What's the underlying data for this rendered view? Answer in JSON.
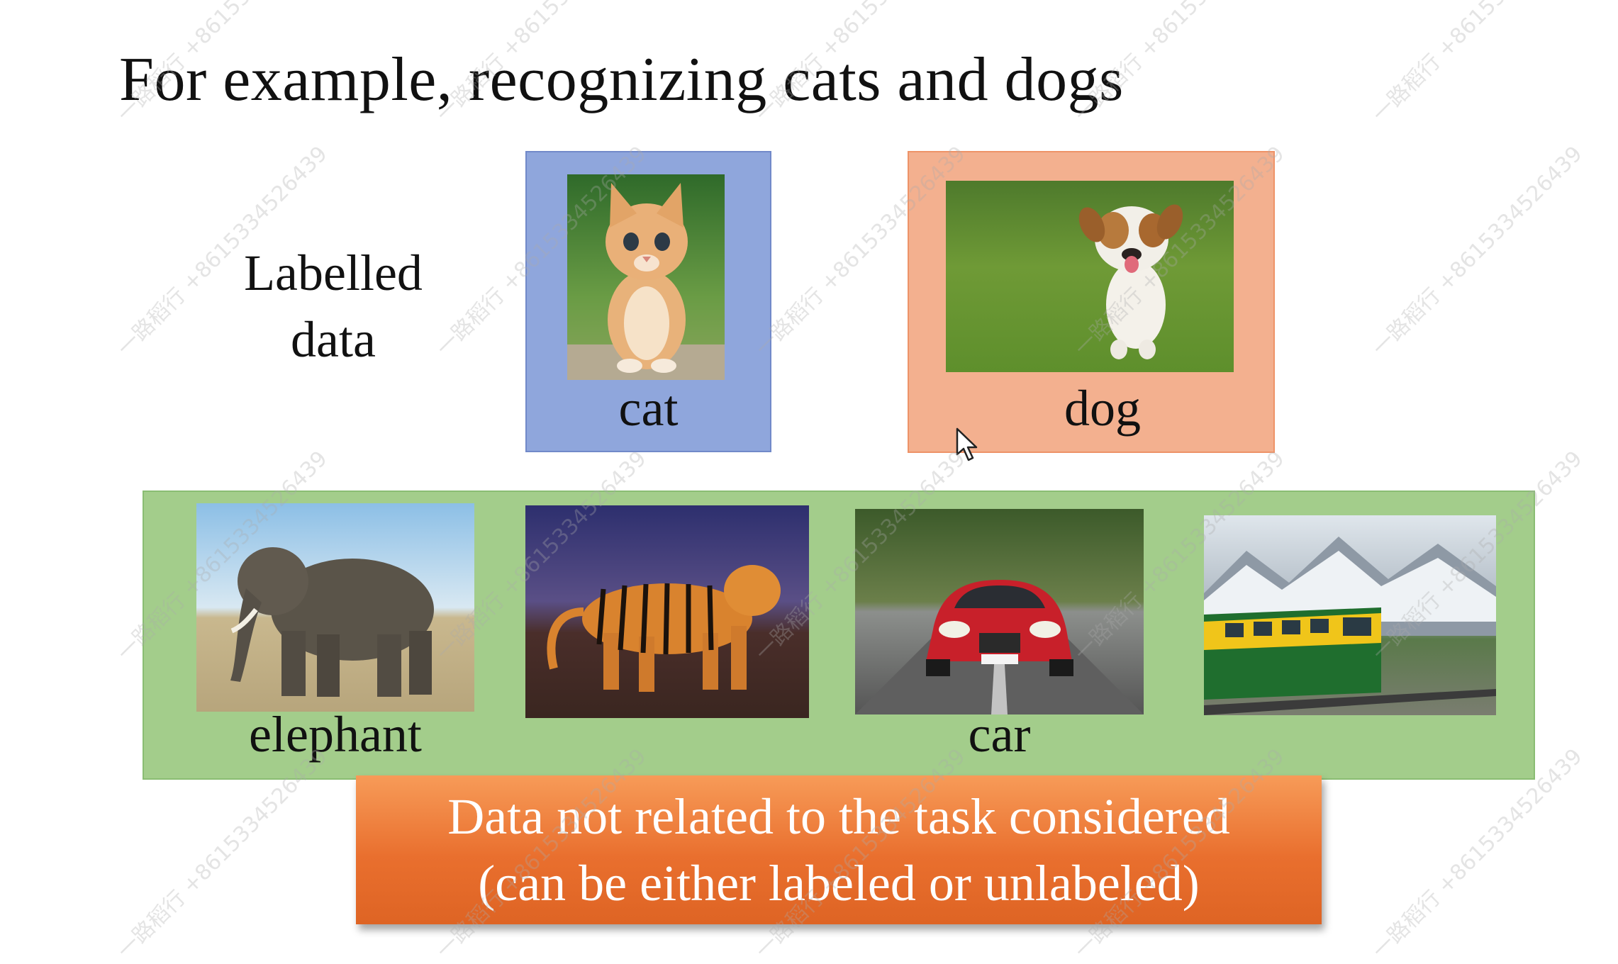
{
  "slide": {
    "title": "For example, recognizing cats and dogs",
    "side_label_line1": "Labelled",
    "side_label_line2": "data",
    "labels": {
      "cat": "cat",
      "dog": "dog",
      "elephant": "elephant",
      "car": "car"
    },
    "callout_line1": "Data not related to the task considered",
    "callout_line2": "(can be either labeled or unlabeled)",
    "watermark": "一路稻行 +8615334526439"
  },
  "colors": {
    "cat_box": "#8fa6dc",
    "dog_box": "#f3b08f",
    "other_box": "#a3cd8b",
    "callout": "#e96f2e"
  },
  "icons": {
    "cursor": "mouse-pointer-icon"
  }
}
